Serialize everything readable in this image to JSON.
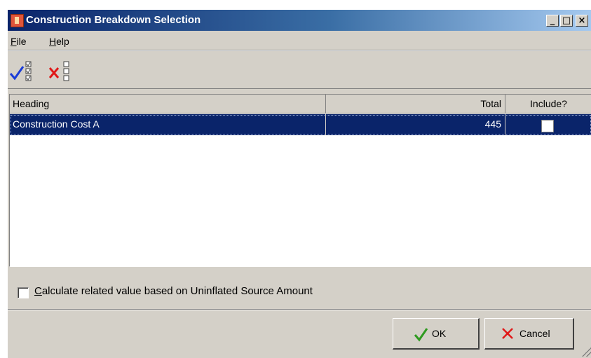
{
  "window": {
    "title": "Construction Breakdown Selection",
    "buttons": {
      "minimize": "_",
      "maximize": "□",
      "close": "×"
    }
  },
  "menu": {
    "file": "File",
    "help": "Help"
  },
  "toolbar": {
    "select_all_icon": "check-all-icon",
    "deselect_all_icon": "uncheck-all-icon"
  },
  "grid": {
    "columns": {
      "heading": "Heading",
      "total": "Total",
      "include": "Include?"
    },
    "rows": [
      {
        "heading": "Construction Cost A",
        "total": "445",
        "include": false
      }
    ]
  },
  "options": {
    "uninflated_label": "Calculate related value based on Uninflated Source Amount",
    "uninflated_checked": false
  },
  "buttons": {
    "ok": "OK",
    "cancel": "Cancel"
  },
  "colors": {
    "title_start": "#0a246a",
    "title_end": "#a6caf0",
    "selection": "#0a246a",
    "ok_icon": "#2e9a1f",
    "cancel_icon": "#e01818",
    "check_icon": "#1a3cd8"
  }
}
